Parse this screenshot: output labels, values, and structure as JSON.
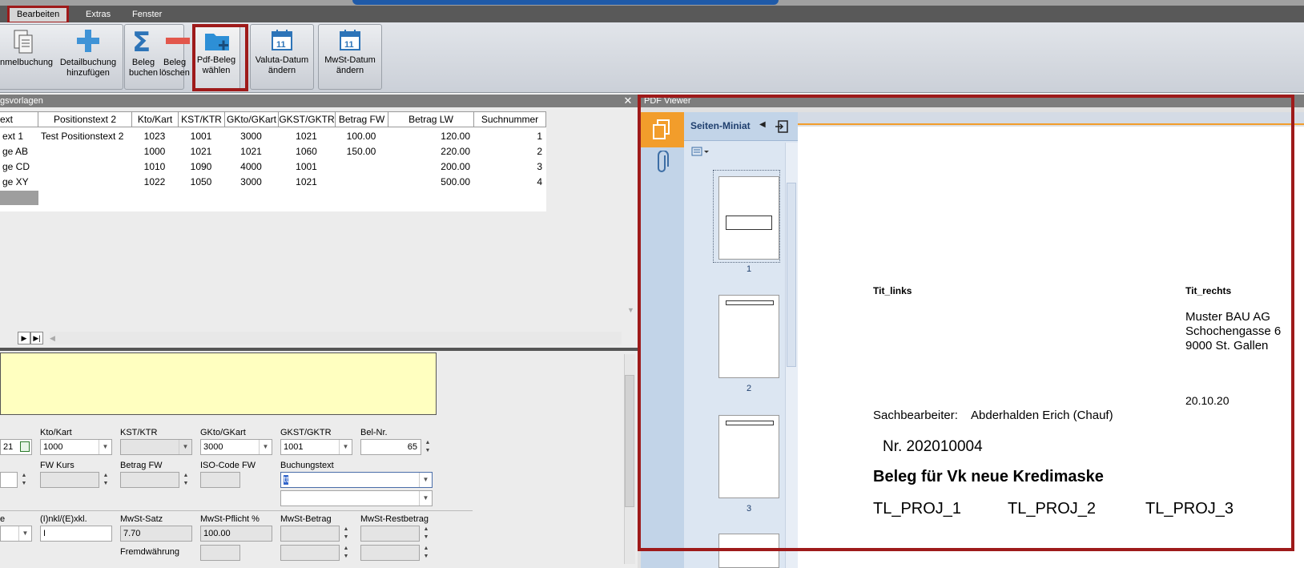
{
  "menu": {
    "items": [
      "Bearbeiten",
      "Extras",
      "Fenster"
    ]
  },
  "ribbon": {
    "buttons": [
      {
        "label": "nmelbuchung",
        "icon": "documents-icon"
      },
      {
        "label1": "Detailbuchung",
        "label2": "hinzufügen",
        "icon": "plus-icon"
      },
      {
        "label1": "Beleg",
        "label2": "buchen",
        "icon": "sigma-icon"
      },
      {
        "label1": "Beleg",
        "label2": "löschen",
        "icon": "minus-icon"
      },
      {
        "label1": "Pdf-Beleg",
        "label2": "wählen",
        "icon": "folder-add-icon"
      },
      {
        "label1": "Valuta-Datum",
        "label2": "ändern",
        "icon": "calendar-icon",
        "day": "11"
      },
      {
        "label1": "MwSt-Datum",
        "label2": "ändern",
        "icon": "calendar-icon",
        "day": "11"
      }
    ]
  },
  "templates": {
    "title": "gsvorlagen",
    "columns": [
      "ext",
      "Positionstext 2",
      "Kto/Kart",
      "KST/KTR",
      "GKto/GKart",
      "GKST/GKTR",
      "Betrag FW",
      "Betrag LW",
      "Suchnummer"
    ],
    "rows": [
      [
        "ext 1",
        "Test Positionstext 2",
        "1023",
        "1001",
        "3000",
        "1021",
        "100.00",
        "120.00",
        "1"
      ],
      [
        "ge AB",
        "",
        "1000",
        "1021",
        "1021",
        "1060",
        "150.00",
        "220.00",
        "2"
      ],
      [
        "ge CD",
        "",
        "1010",
        "1090",
        "4000",
        "1001",
        "",
        "200.00",
        "3"
      ],
      [
        "ge XY",
        "",
        "1022",
        "1050",
        "3000",
        "1021",
        "",
        "500.00",
        "4"
      ]
    ]
  },
  "form": {
    "labels": {
      "kto": "Kto/Kart",
      "kst": "KST/KTR",
      "gkto": "GKto/GKart",
      "gkst": "GKST/GKTR",
      "belnr": "Bel-Nr.",
      "fwkurs": "FW Kurs",
      "betragfw": "Betrag FW",
      "iso": "ISO-Code FW",
      "buchungstext": "Buchungstext",
      "e": "e",
      "inkl": "(I)nkl/(E)xkl.",
      "mwstsatz": "MwSt-Satz",
      "mwstpflicht": "MwSt-Pflicht %",
      "mwstbetrag": "MwSt-Betrag",
      "mwstrest": "MwSt-Restbetrag",
      "fremd": "Fremdwährung"
    },
    "values": {
      "date": "21",
      "kto": "1000",
      "gkto": "3000",
      "gkst": "1001",
      "belnr": "65",
      "buchungstext": "tt",
      "inkl": "I",
      "mwstsatz": "7.70",
      "mwstpflicht": "100.00"
    }
  },
  "pdf": {
    "title": "PDF Viewer",
    "sidebar_title": "Seiten-Miniat",
    "pages": [
      "1",
      "2",
      "3"
    ],
    "doc": {
      "tit_links": "Tit_links",
      "tit_rechts": "Tit_rechts",
      "addr1": "Muster BAU AG",
      "addr2": "Schochengasse 6",
      "addr3": "9000 St. Gallen",
      "date": "20.10.20",
      "sb_label": "Sachbearbeiter:",
      "sb_name": "Abderhalden Erich (Chauf)",
      "nr": "Nr. 202010004",
      "heading": "Beleg für Vk neue Kredimaske",
      "proj1": "TL_PROJ_1",
      "proj2": "TL_PROJ_2",
      "proj3": "TL_PROJ_3"
    }
  }
}
